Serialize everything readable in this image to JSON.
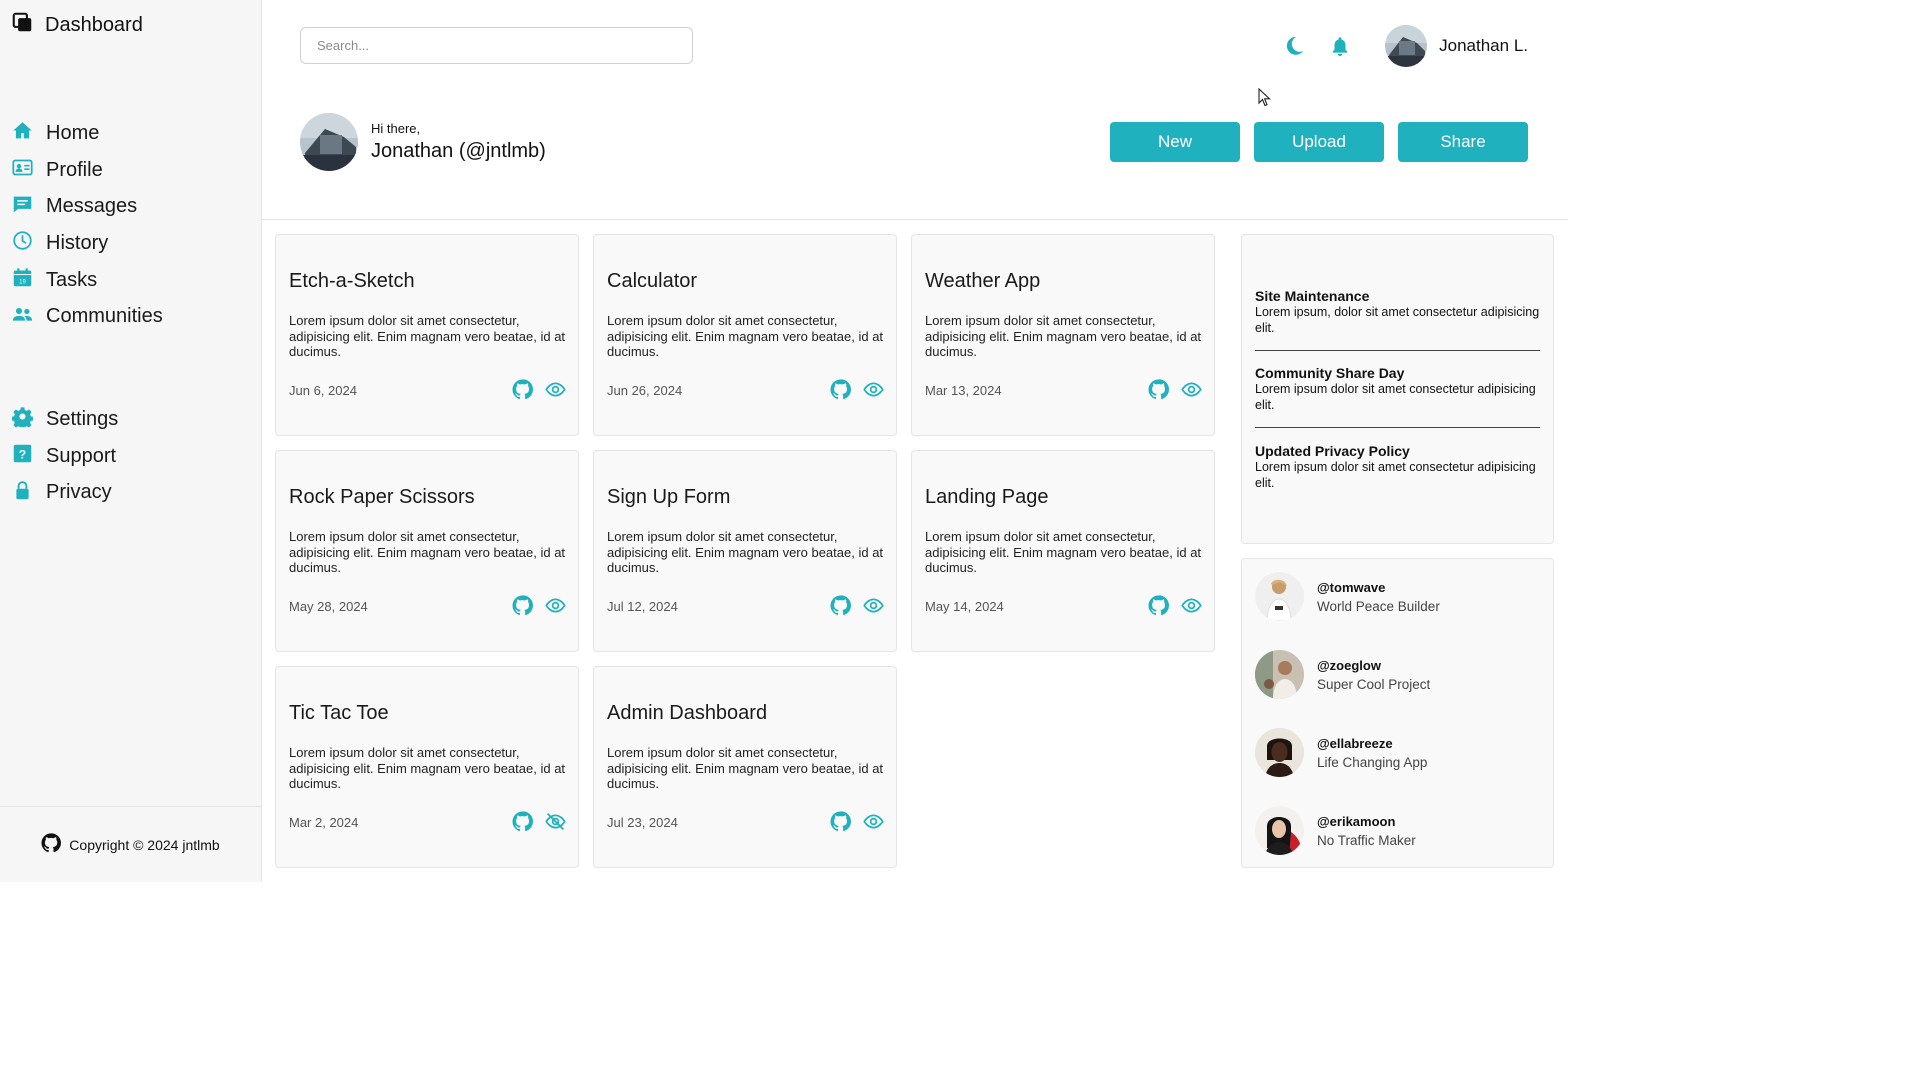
{
  "sidebar": {
    "title": "Dashboard",
    "nav_main": [
      {
        "label": "Home",
        "icon": "home-icon"
      },
      {
        "label": "Profile",
        "icon": "profile-card-icon"
      },
      {
        "label": "Messages",
        "icon": "message-icon"
      },
      {
        "label": "History",
        "icon": "history-icon"
      },
      {
        "label": "Tasks",
        "icon": "calendar-icon"
      },
      {
        "label": "Communities",
        "icon": "users-icon"
      }
    ],
    "nav_secondary": [
      {
        "label": "Settings",
        "icon": "gear-icon"
      },
      {
        "label": "Support",
        "icon": "help-icon"
      },
      {
        "label": "Privacy",
        "icon": "lock-icon"
      }
    ],
    "footer": "Copyright © 2024 jntlmb"
  },
  "header": {
    "search_placeholder": "Search...",
    "user_name": "Jonathan L.",
    "greeting_small": "Hi there,",
    "greeting_name": "Jonathan (@jntlmb)",
    "buttons": [
      "New",
      "Upload",
      "Share"
    ]
  },
  "colors": {
    "accent": "#1fb1bd",
    "sidebar_bg": "#f6f6f6",
    "card_bg": "#f9f9f9"
  },
  "projects": [
    {
      "title": "Etch-a-Sketch",
      "desc": "Lorem ipsum dolor sit amet consectetur, adipisicing elit. Enim magnam vero beatae, id at ducimus.",
      "date": "Jun 6, 2024",
      "visibility": "visible"
    },
    {
      "title": "Calculator",
      "desc": "Lorem ipsum dolor sit amet consectetur, adipisicing elit. Enim magnam vero beatae, id at ducimus.",
      "date": "Jun 26, 2024",
      "visibility": "visible"
    },
    {
      "title": "Weather App",
      "desc": "Lorem ipsum dolor sit amet consectetur, adipisicing elit. Enim magnam vero beatae, id at ducimus.",
      "date": "Mar 13, 2024",
      "visibility": "visible"
    },
    {
      "title": "Rock Paper Scissors",
      "desc": "Lorem ipsum dolor sit amet consectetur, adipisicing elit. Enim magnam vero beatae, id at ducimus.",
      "date": "May 28, 2024",
      "visibility": "visible"
    },
    {
      "title": "Sign Up Form",
      "desc": "Lorem ipsum dolor sit amet consectetur, adipisicing elit. Enim magnam vero beatae, id at ducimus.",
      "date": "Jul 12, 2024",
      "visibility": "visible"
    },
    {
      "title": "Landing Page",
      "desc": "Lorem ipsum dolor sit amet consectetur, adipisicing elit. Enim magnam vero beatae, id at ducimus.",
      "date": "May 14, 2024",
      "visibility": "visible"
    },
    {
      "title": "Tic Tac Toe",
      "desc": "Lorem ipsum dolor sit amet consectetur, adipisicing elit. Enim magnam vero beatae, id at ducimus.",
      "date": "Mar 2, 2024",
      "visibility": "hidden"
    },
    {
      "title": "Admin Dashboard",
      "desc": "Lorem ipsum dolor sit amet consectetur, adipisicing elit. Enim magnam vero beatae, id at ducimus.",
      "date": "Jul 23, 2024",
      "visibility": "visible"
    }
  ],
  "announcements": [
    {
      "title": "Site Maintenance",
      "text": "Lorem ipsum, dolor sit amet consectetur adipisicing elit."
    },
    {
      "title": "Community Share Day",
      "text": "Lorem ipsum dolor sit amet consectetur adipisicing elit."
    },
    {
      "title": "Updated Privacy Policy",
      "text": "Lorem ipsum dolor sit amet consectetur adipisicing elit."
    }
  ],
  "trending": [
    {
      "handle": "@tomwave",
      "project": "World Peace Builder"
    },
    {
      "handle": "@zoeglow",
      "project": "Super Cool Project"
    },
    {
      "handle": "@ellabreeze",
      "project": "Life Changing App"
    },
    {
      "handle": "@erikamoon",
      "project": "No Traffic Maker"
    }
  ]
}
